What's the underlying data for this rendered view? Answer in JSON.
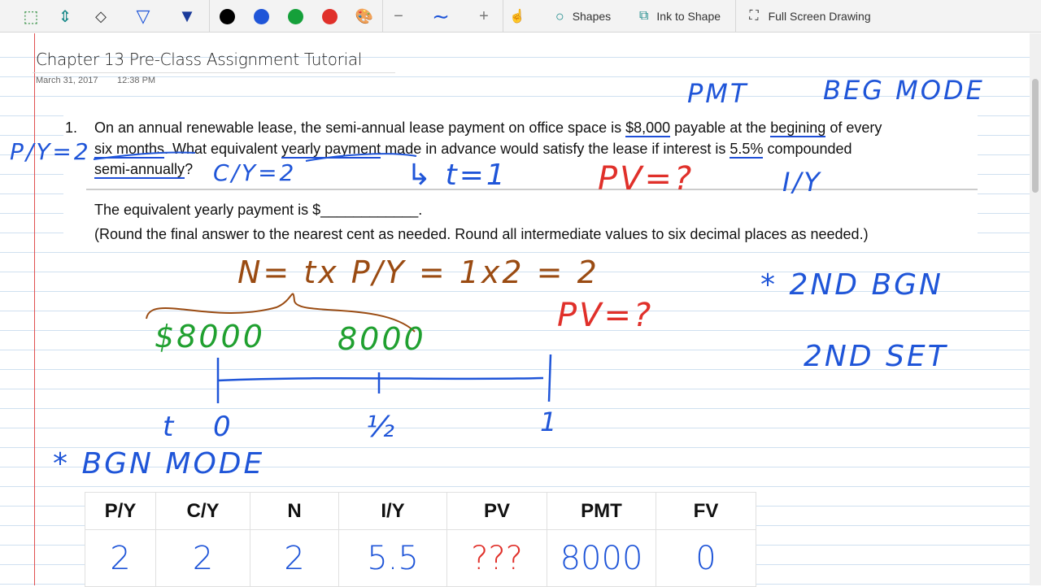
{
  "toolbar": {
    "tools": [
      "lasso-select-icon",
      "insert-space-icon",
      "eraser-icon",
      "pen-icon",
      "highlighter-icon"
    ],
    "colors": [
      "#000000",
      "#1f55d8",
      "#15a03a",
      "#e0302a"
    ],
    "shapes_label": "Shapes",
    "ink_to_shape_label": "Ink to Shape",
    "full_screen_label": "Full Screen Drawing"
  },
  "page": {
    "title": "Chapter 13 Pre-Class Assignment Tutorial",
    "date": "March 31, 2017",
    "time": "12:38 PM"
  },
  "question": {
    "number": "1.",
    "line1a": "On an annual renewable lease, the semi-annual lease payment on office space is ",
    "amount": "$8,000",
    "line1b": " payable at the ",
    "begining": "begining",
    "line1c": " of every",
    "six_months": "six months",
    "line2a": ". What equivalent ",
    "yearly_payment": "yearly payment",
    "line2b": " made in advance would satisfy the lease if interest is ",
    "rate": "5.5%",
    "line2c": " compounded",
    "semi": "semi-annually",
    "q": "?",
    "answer_prefix": "The equivalent yearly payment is $",
    "answer_blank": "____________",
    "answer_suffix": ".",
    "instructions": "(Round the final answer to the nearest cent as needed. Round all intermediate values to six decimal places as needed.)"
  },
  "ink": {
    "pmt": "PMT",
    "beg_mode": "BEG  MODE",
    "py2": "P/Y=2",
    "cy2": "C/Y=2",
    "arrow_t1": "↳  t=1",
    "pv_q1": "PV=?",
    "iy": "I/Y",
    "n_formula": "N= tx P/Y = 1x2 = 2",
    "pv_q2": "PV=?",
    "pay1": "$8000",
    "pay2": "8000",
    "t_label": "t",
    "t0": "0",
    "thalf": "½",
    "t1": "1",
    "second_bgn": "* 2ND  BGN",
    "second_set": "2ND  SET",
    "bgn_mode": "* BGN  MODE"
  },
  "table": {
    "headers": [
      "P/Y",
      "C/Y",
      "N",
      "I/Y",
      "PV",
      "PMT",
      "FV"
    ],
    "values": [
      "2",
      "2",
      "2",
      "5.5",
      "???",
      "8000",
      "0"
    ]
  }
}
